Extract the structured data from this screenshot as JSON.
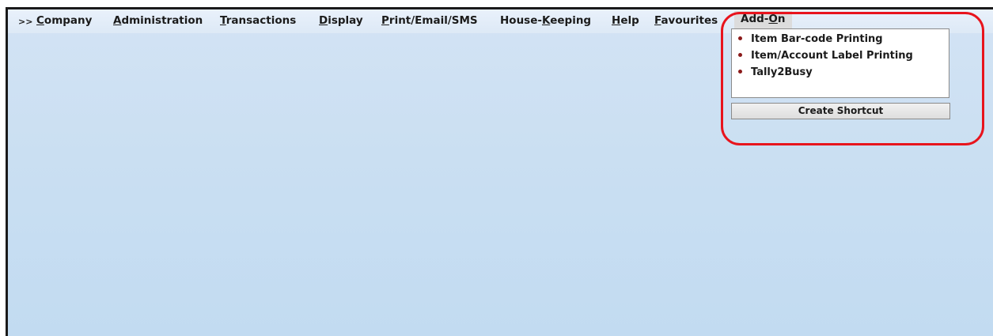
{
  "menubar": {
    "chevron": ">>",
    "items": [
      {
        "pre": "",
        "acc": "C",
        "post": "ompany"
      },
      {
        "pre": "",
        "acc": "A",
        "post": "dministration"
      },
      {
        "pre": "",
        "acc": "T",
        "post": "ransactions"
      },
      {
        "pre": "",
        "acc": "D",
        "post": "isplay"
      },
      {
        "pre": "",
        "acc": "P",
        "post": "rint/Email/SMS"
      },
      {
        "pre": "House-",
        "acc": "K",
        "post": "eeping"
      },
      {
        "pre": "",
        "acc": "H",
        "post": "elp"
      },
      {
        "pre": "",
        "acc": "F",
        "post": "avourites"
      },
      {
        "pre": "Add-",
        "acc": "O",
        "post": "n"
      }
    ]
  },
  "addon_menu": {
    "items": [
      "Item Bar-code Printing",
      "Item/Account Label Printing",
      "Tally2Busy"
    ],
    "create_shortcut_label": "Create Shortcut"
  },
  "colors": {
    "highlight": "#e8141d",
    "background": "#cadff2",
    "bullet": "#8b1a1a"
  }
}
